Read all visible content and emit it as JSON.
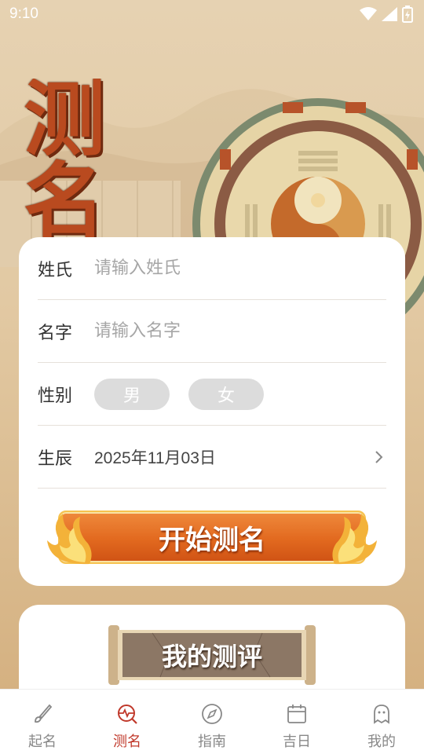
{
  "status_bar": {
    "time": "9:10"
  },
  "hero": {
    "title_chars": [
      "测",
      "名"
    ]
  },
  "form": {
    "surname": {
      "label": "姓氏",
      "placeholder": "请输入姓氏"
    },
    "name": {
      "label": "名字",
      "placeholder": "请输入名字"
    },
    "gender": {
      "label": "性别",
      "male": "男",
      "female": "女"
    },
    "birth": {
      "label": "生辰",
      "value": "2025年11月03日"
    },
    "start_button": "开始测名"
  },
  "review": {
    "title": "我的测评"
  },
  "tabs": [
    {
      "label": "起名",
      "icon": "brush-icon"
    },
    {
      "label": "测名",
      "icon": "pulse-search-icon",
      "active": true
    },
    {
      "label": "指南",
      "icon": "compass-icon"
    },
    {
      "label": "吉日",
      "icon": "calendar-icon"
    },
    {
      "label": "我的",
      "icon": "ghost-icon"
    }
  ],
  "colors": {
    "accent": "#c0392b",
    "button_orange": "#e2691f",
    "title_brown": "#b94a1f"
  }
}
